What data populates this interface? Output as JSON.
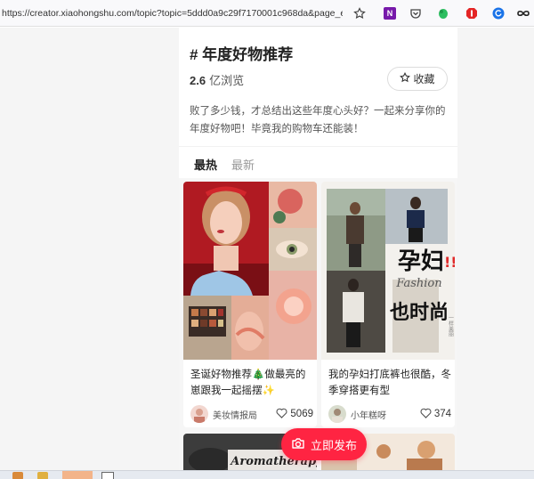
{
  "browser": {
    "url": "https://creator.xiaohongshu.com/topic?topic=5ddd0a9c29f7170001c968da&page_entran...",
    "icons": [
      "bookmark-star-icon",
      "onenote-extension-icon",
      "pocket-icon",
      "evernote-icon",
      "adblock-icon",
      "refresh-extension-icon",
      "infinity-menu-icon"
    ]
  },
  "topic": {
    "title": "# 年度好物推荐",
    "views_number": "2.6",
    "views_unit": "亿浏览",
    "favorite_label": "收藏",
    "description": "败了多少钱，才总结出这些年度心头好？一起来分享你的年度好物吧！毕竟我的购物车还能装！"
  },
  "tabs": {
    "hot": "最热",
    "latest": "最新"
  },
  "cards": [
    {
      "title": "圣诞好物推荐🎄做最亮的崽跟我一起摇摆✨",
      "author": "美妆情报局",
      "likes": "5069"
    },
    {
      "title": "我的孕妇打底裤也很酷，冬季穿搭更有型",
      "author": "小年糕呀",
      "likes": "374",
      "image_text": {
        "line1": "孕妇",
        "line2": "也时尚",
        "script": "Fashion",
        "side": "一样美丽"
      }
    }
  ],
  "next_cards": [
    {
      "image_text": "Aromatherapy"
    }
  ],
  "publish_label": "立即发布",
  "colors": {
    "accent": "#ff2442",
    "page_bg": "#f5f5f5"
  }
}
